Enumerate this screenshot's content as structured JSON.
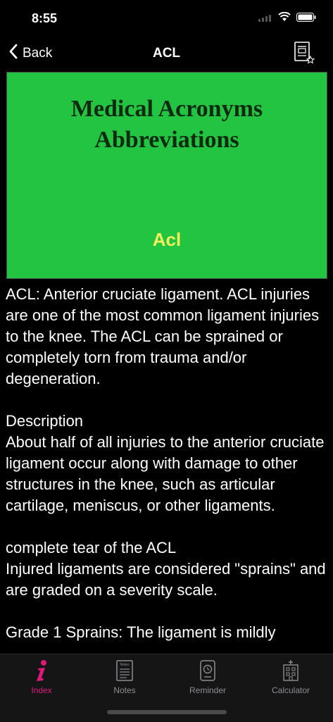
{
  "status": {
    "time": "8:55"
  },
  "nav": {
    "back_label": "Back",
    "title": "ACL"
  },
  "banner": {
    "title_line1": "Medical Acronyms",
    "title_line2": "Abbreviations",
    "subtitle": "Acl",
    "bg_color": "#22c442",
    "title_color": "#0b2a0f",
    "subtitle_color": "#f3ee5b"
  },
  "content": {
    "paragraphs": [
      "ACL: Anterior cruciate ligament. ACL injuries are one of the most common ligament injuries to the knee. The ACL can be sprained or completely torn from trauma and/or degeneration.",
      "Description\nAbout half of all injuries to the anterior cruciate ligament occur along with damage to other structures in the knee, such as articular cartilage, meniscus, or other ligaments.",
      "complete tear of the ACL\nInjured ligaments are considered \"sprains\" and are graded on a severity scale.",
      "Grade 1 Sprains: The ligament is mildly"
    ]
  },
  "tabbar": {
    "tabs": [
      {
        "label": "Index",
        "icon": "info-icon"
      },
      {
        "label": "Notes",
        "icon": "notes-icon"
      },
      {
        "label": "Reminder",
        "icon": "reminder-icon"
      },
      {
        "label": "Calculator",
        "icon": "calculator-icon"
      }
    ],
    "active_color": "#e0187a"
  }
}
